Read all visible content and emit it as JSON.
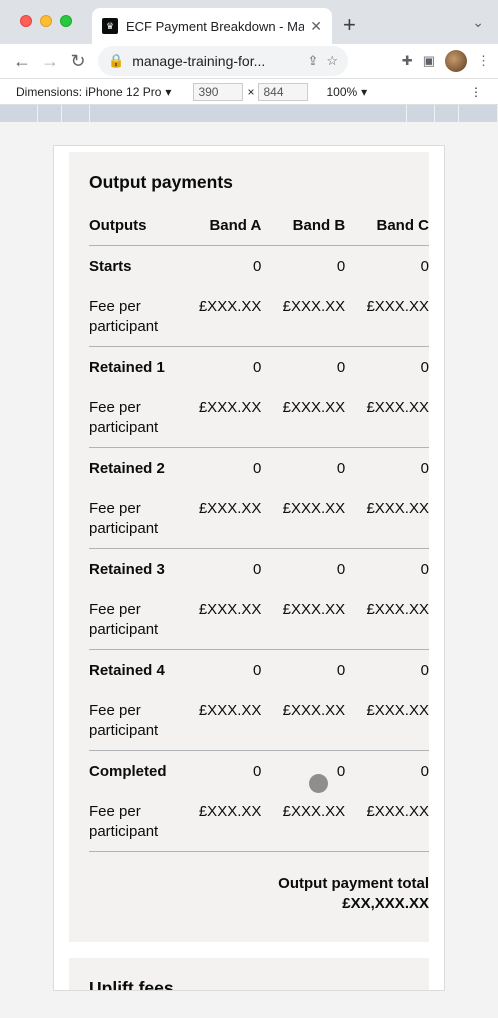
{
  "browser": {
    "tab_title": "ECF Payment Breakdown - Man",
    "url": "manage-training-for...",
    "devtools": {
      "device": "Dimensions: iPhone 12 Pro",
      "width": "390",
      "height": "844",
      "zoom": "100%"
    }
  },
  "output_payments": {
    "title": "Output payments",
    "headers": [
      "Outputs",
      "Band A",
      "Band B",
      "Band C"
    ],
    "rows": [
      {
        "label": "Starts",
        "values": [
          "0",
          "0",
          "0"
        ],
        "fee_label": "Fee per participant",
        "fees": [
          "£XXX.XX",
          "£XXX.XX",
          "£XXX.XX"
        ]
      },
      {
        "label": "Retained 1",
        "values": [
          "0",
          "0",
          "0"
        ],
        "fee_label": "Fee per participant",
        "fees": [
          "£XXX.XX",
          "£XXX.XX",
          "£XXX.XX"
        ]
      },
      {
        "label": "Retained 2",
        "values": [
          "0",
          "0",
          "0"
        ],
        "fee_label": "Fee per participant",
        "fees": [
          "£XXX.XX",
          "£XXX.XX",
          "£XXX.XX"
        ]
      },
      {
        "label": "Retained 3",
        "values": [
          "0",
          "0",
          "0"
        ],
        "fee_label": "Fee per participant",
        "fees": [
          "£XXX.XX",
          "£XXX.XX",
          "£XXX.XX"
        ]
      },
      {
        "label": "Retained 4",
        "values": [
          "0",
          "0",
          "0"
        ],
        "fee_label": "Fee per participant",
        "fees": [
          "£XXX.XX",
          "£XXX.XX",
          "£XXX.XX"
        ]
      },
      {
        "label": "Completed",
        "values": [
          "0",
          "0",
          "0"
        ],
        "fee_label": "Fee per participant",
        "fees": [
          "£XXX.XX",
          "£XXX.XX",
          "£XXX.XX"
        ]
      }
    ],
    "total_label": "Output payment total",
    "total_value": "£XX,XXX.XX"
  },
  "uplift_fees": {
    "title": "Uplift fees"
  }
}
